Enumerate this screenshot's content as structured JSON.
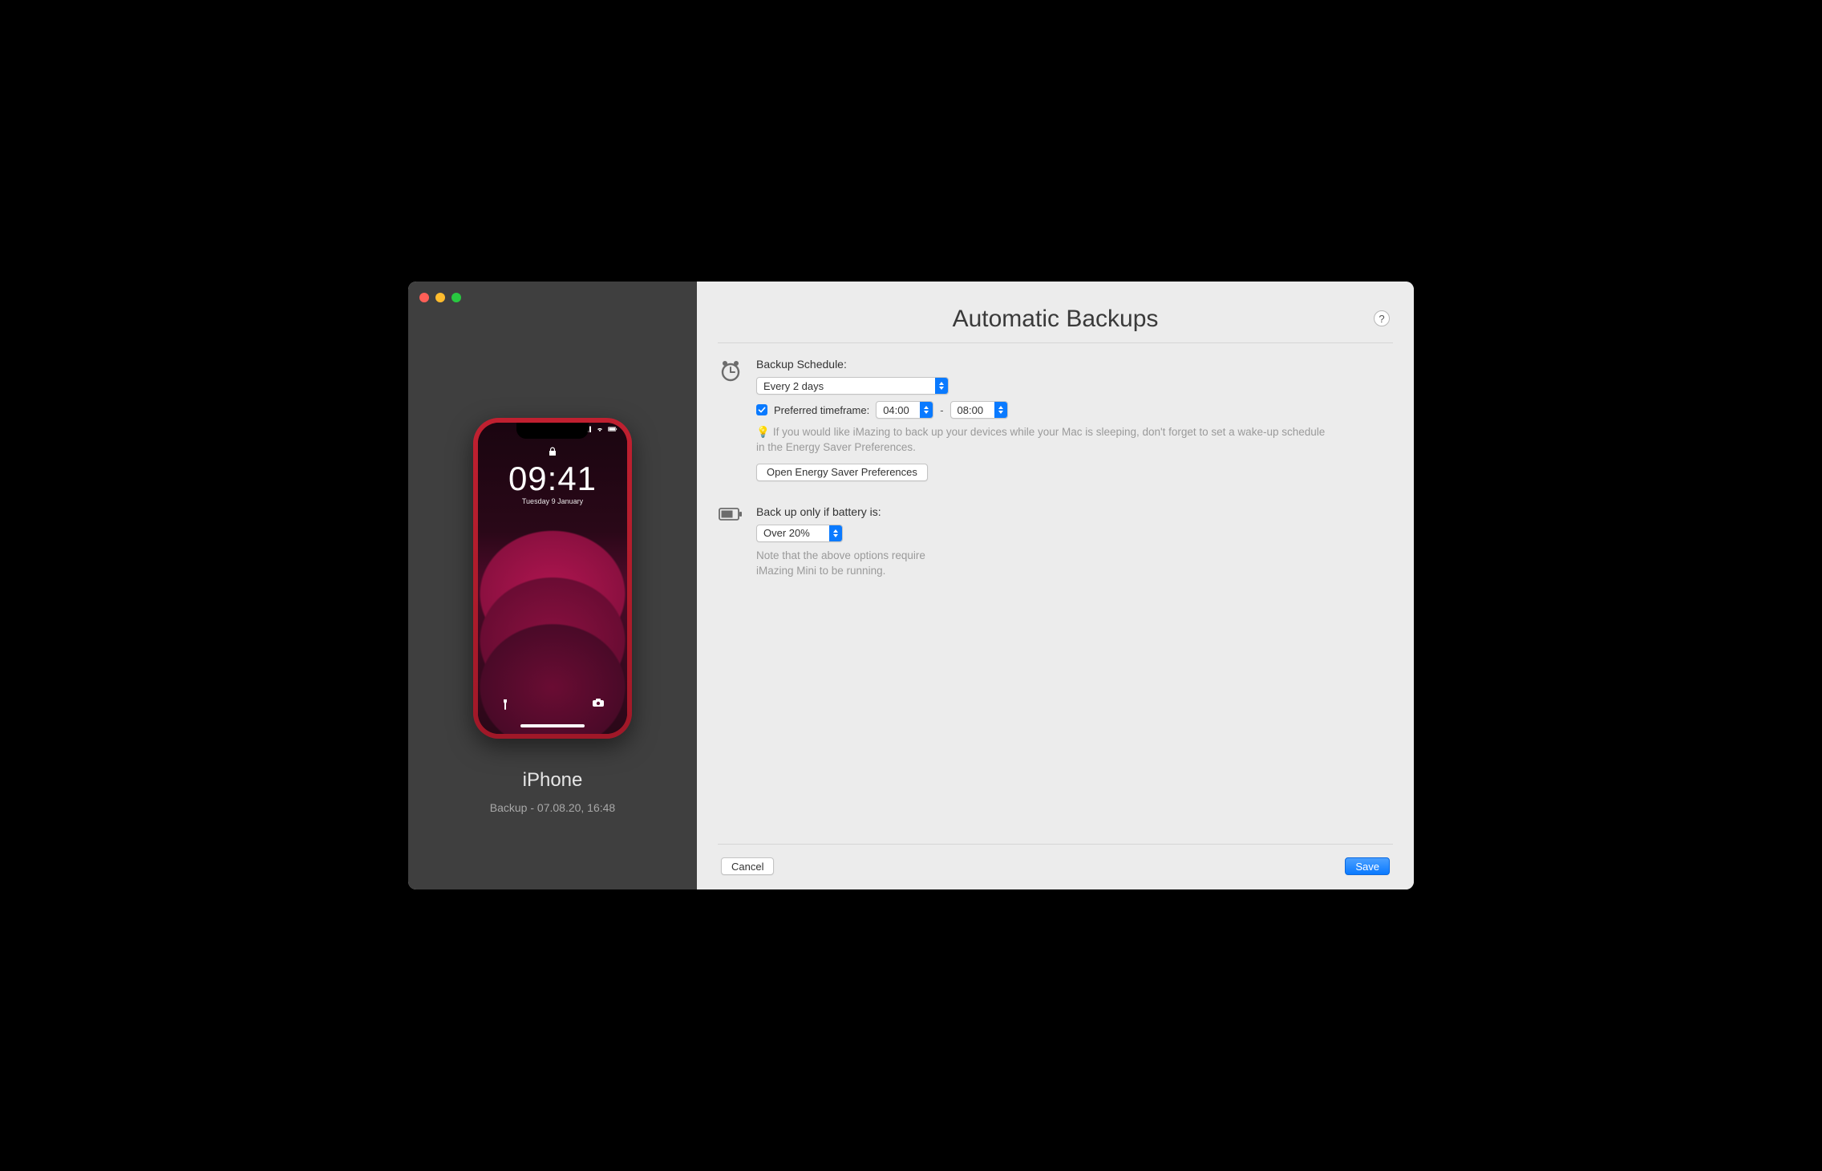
{
  "sidebar": {
    "device_name": "iPhone",
    "device_sub": "Backup - 07.08.20, 16:48",
    "lock_time": "09:41",
    "lock_date": "Tuesday 9 January"
  },
  "main": {
    "title": "Automatic Backups",
    "help_label": "?",
    "schedule": {
      "label": "Backup Schedule:",
      "value": "Every 2 days",
      "preferred_label": "Preferred timeframe:",
      "preferred_checked": true,
      "time_from": "04:00",
      "time_to": "08:00",
      "dash": "-",
      "hint_bulb": "💡",
      "hint": "If you would like iMazing to back up your devices while your Mac is sleeping, don't forget to set a wake-up schedule in the Energy Saver Preferences.",
      "open_prefs": "Open Energy Saver Preferences"
    },
    "battery": {
      "label": "Back up only if battery is:",
      "value": "Over 20%",
      "hint": "Note that the above options require iMazing Mini to be running."
    },
    "footer": {
      "cancel": "Cancel",
      "save": "Save"
    }
  }
}
